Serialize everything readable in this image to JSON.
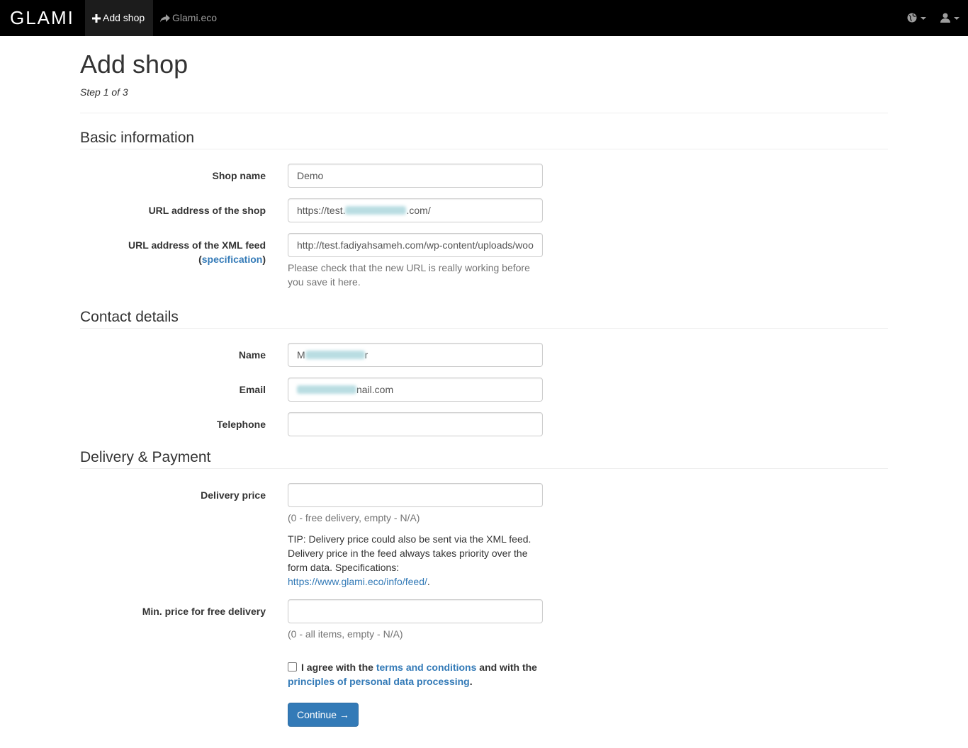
{
  "navbar": {
    "brand": "GLAMI",
    "add_shop": "Add shop",
    "glami_eco": "Glami.eco"
  },
  "page": {
    "title": "Add shop",
    "step": "Step 1 of 3"
  },
  "basic": {
    "heading": "Basic information",
    "shop_name_label": "Shop name",
    "shop_name_value": "Demo",
    "url_label": "URL address of the shop",
    "url_prefix": "https://test.",
    "url_suffix": ".com/",
    "feed_label": "URL address of the XML feed",
    "feed_spec_open": "(",
    "feed_spec_link": "specification",
    "feed_spec_close": ")",
    "feed_value": "http://test.fadiyahsameh.com/wp-content/uploads/woo",
    "feed_help": "Please check that the new URL is really working before you save it here."
  },
  "contact": {
    "heading": "Contact details",
    "name_label": "Name",
    "name_prefix": "M",
    "name_suffix": "r",
    "email_label": "Email",
    "email_suffix": "nail.com",
    "phone_label": "Telephone",
    "phone_value": ""
  },
  "delivery": {
    "heading": "Delivery & Payment",
    "price_label": "Delivery price",
    "price_value": "",
    "price_help": "(0 - free delivery, empty - N/A)",
    "tip_text": "TIP: Delivery price could also be sent via the XML feed. Delivery price in the feed always takes priority over the form data. Specifications:",
    "tip_link": "https://www.glami.eco/info/feed/",
    "tip_end": ".",
    "min_label": "Min. price for free delivery",
    "min_value": "",
    "min_help": "(0 - all items, empty - N/A)"
  },
  "agree": {
    "text1": "I agree with the",
    "terms_link": "terms and conditions",
    "text2": "and with the",
    "privacy_link": "principles of personal data processing",
    "text3": "."
  },
  "continue_button": "Continue →",
  "colors": {
    "navbar": "#000000",
    "link": "#337ab7",
    "primary_button": "#337ab7"
  }
}
